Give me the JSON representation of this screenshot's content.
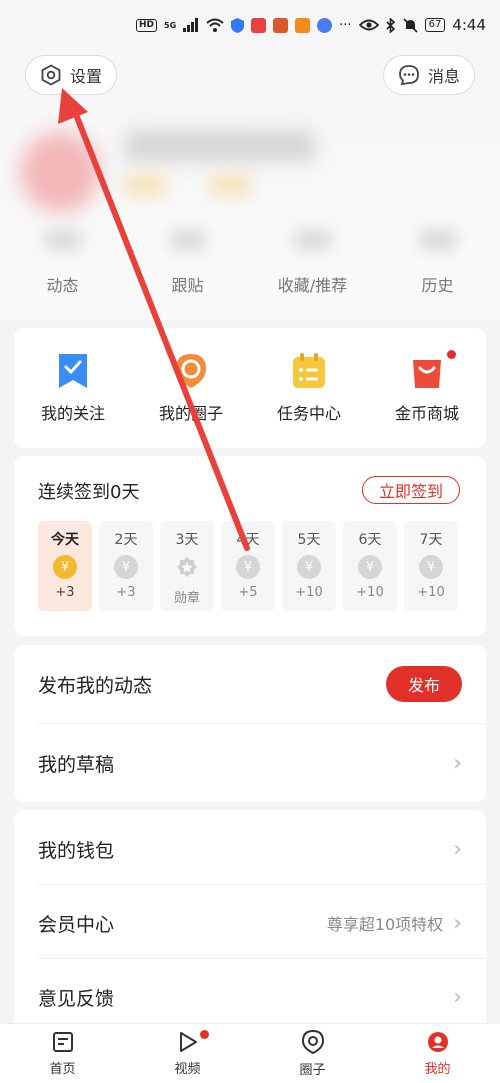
{
  "status_bar": {
    "network_badge": "HD",
    "network_type": "5G",
    "battery": "67",
    "time": "4:44",
    "dots": "···"
  },
  "header": {
    "settings_label": "设置",
    "messages_label": "消息"
  },
  "stats": [
    {
      "label": "动态"
    },
    {
      "label": "跟贴"
    },
    {
      "label": "收藏/推荐"
    },
    {
      "label": "历史"
    }
  ],
  "quick_actions": [
    {
      "label": "我的关注",
      "icon": "bookmark-icon"
    },
    {
      "label": "我的圈子",
      "icon": "location-circle-icon"
    },
    {
      "label": "任务中心",
      "icon": "task-clipboard-icon"
    },
    {
      "label": "金币商城",
      "icon": "shopping-bag-icon"
    }
  ],
  "sign_in": {
    "title": "连续签到0天",
    "button_label": "立即签到",
    "days": [
      {
        "label": "今天",
        "reward": "+3",
        "icon": "coin-icon",
        "today": true
      },
      {
        "label": "2天",
        "reward": "+3",
        "icon": "coin-icon"
      },
      {
        "label": "3天",
        "reward": "勋章",
        "icon": "medal-icon"
      },
      {
        "label": "4天",
        "reward": "+5",
        "icon": "coin-icon"
      },
      {
        "label": "5天",
        "reward": "+10",
        "icon": "coin-icon"
      },
      {
        "label": "6天",
        "reward": "+10",
        "icon": "coin-icon"
      },
      {
        "label": "7天",
        "reward": "+10",
        "icon": "coin-icon"
      }
    ],
    "coin_symbol": "¥"
  },
  "post": {
    "publish_row_label": "发布我的动态",
    "publish_button_label": "发布",
    "drafts_label": "我的草稿"
  },
  "wallet_section": {
    "wallet_label": "我的钱包",
    "member_label": "会员中心",
    "member_extra": "尊享超10项特权",
    "feedback_label": "意见反馈"
  },
  "bottom_nav": [
    {
      "label": "首页",
      "icon": "news-icon"
    },
    {
      "label": "视频",
      "icon": "play-icon"
    },
    {
      "label": "圈子",
      "icon": "circle-pin-icon"
    },
    {
      "label": "我的",
      "icon": "profile-icon",
      "active": true
    }
  ],
  "colors": {
    "accent": "#e1302a",
    "coin": "#f4b92e",
    "today_bg": "#fde8e0",
    "annotation_arrow": "#e8413b"
  }
}
